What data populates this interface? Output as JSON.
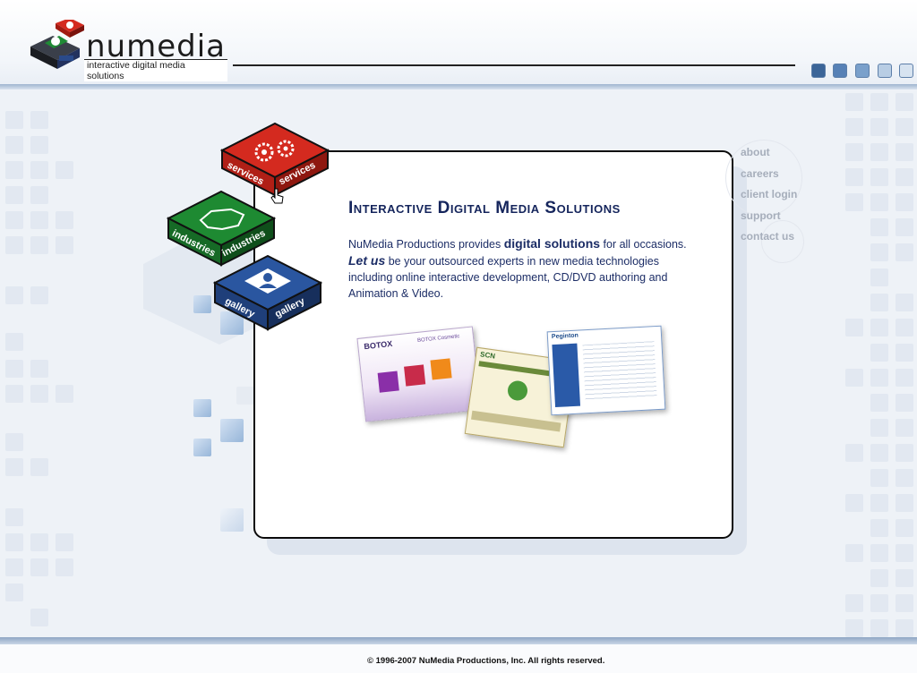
{
  "logo": {
    "wordmark": "numedia",
    "tagline": "interactive digital media solutions"
  },
  "header": {
    "page_dots": [
      "#3c6598",
      "#5781b6",
      "#7aa0cb",
      "#b8cde4",
      "#d7e3f0"
    ]
  },
  "cubes": [
    {
      "label": "services",
      "icon": "gears-icon",
      "color": "#d42a1f"
    },
    {
      "label": "industries",
      "icon": "map-icon",
      "color": "#1e8a32"
    },
    {
      "label": "gallery",
      "icon": "person-icon",
      "color": "#1f3f7a"
    }
  ],
  "main": {
    "title": "Interactive Digital Media Solutions",
    "intro_1": "NuMedia Productions provides ",
    "intro_hl": "digital solutions",
    "intro_2": " for all occasions.",
    "letus": "Let us",
    "intro_3": " be your outsourced experts in new media technologies including online interactive development, CD/DVD authoring and Animation & Video.",
    "screenshots": [
      {
        "caption": "BOTOX",
        "subcaption": "BOTOX Cosmetic"
      },
      {
        "caption": "SCN"
      },
      {
        "caption": "Peginton"
      }
    ]
  },
  "nav": {
    "items": [
      "about",
      "careers",
      "client login",
      "support",
      "contact us"
    ]
  },
  "footer": {
    "copyright": "© 1996-2007 NuMedia Productions, Inc. All rights reserved."
  }
}
